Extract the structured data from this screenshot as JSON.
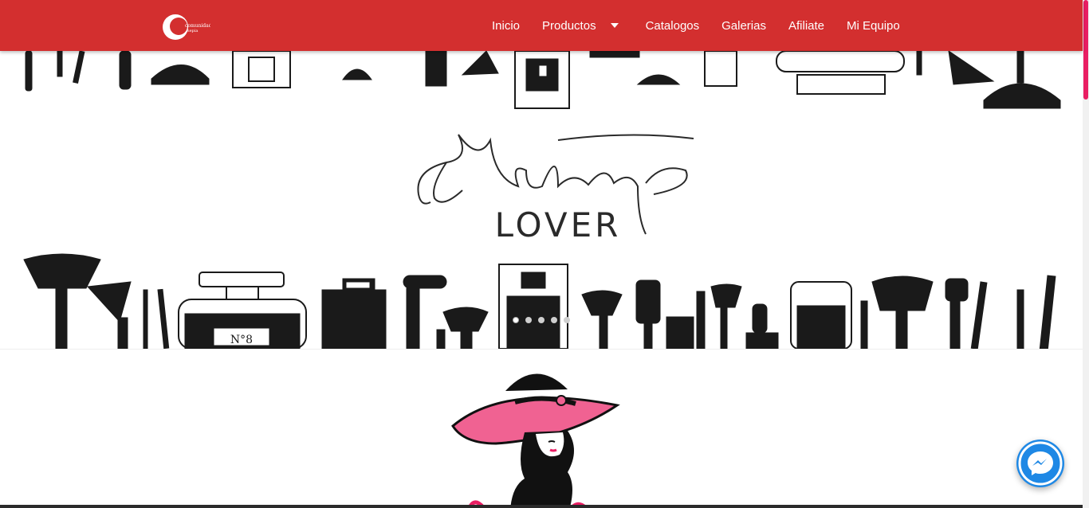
{
  "navbar": {
    "brand_icon": "comunidad-logo",
    "brand_text_line1": "comunidad",
    "brand_text_line2": "sepia",
    "links": [
      {
        "label": "Inicio"
      },
      {
        "label": "Productos",
        "has_dropdown": true
      },
      {
        "label": "Catalogos"
      },
      {
        "label": "Galerias"
      },
      {
        "label": "Afiliate"
      },
      {
        "label": "Mi Equipo"
      }
    ],
    "color": "#d32f2f"
  },
  "hero": {
    "headline": "Makeup",
    "subline": "LOVER",
    "perfume_label": "N°8",
    "carousel": {
      "slides": 5,
      "active": 1
    }
  },
  "logo_section": {
    "icon": "lady-with-hat-logo",
    "accent": "#f06292"
  },
  "messenger": {
    "icon": "messenger-icon",
    "color": "#1e88e5"
  },
  "scrollbar": {
    "thumb_color": "#e91e63"
  }
}
